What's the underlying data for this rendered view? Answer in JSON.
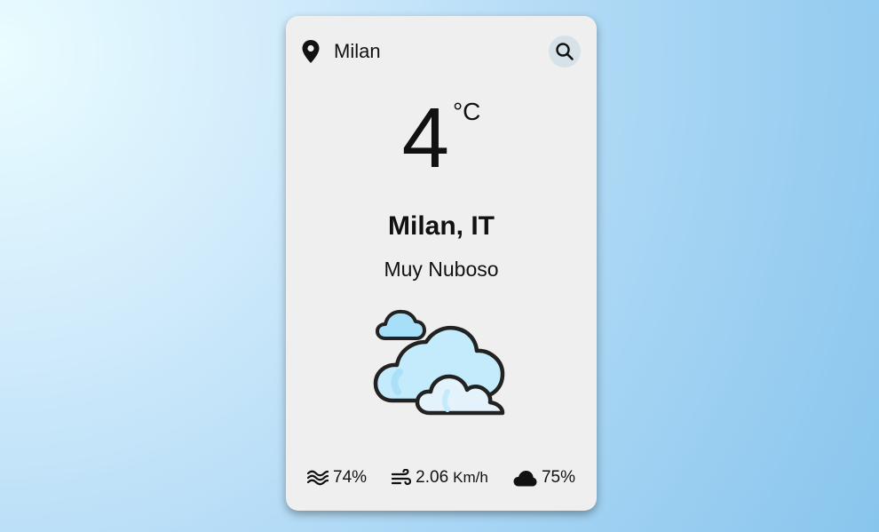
{
  "header": {
    "location": "Milan",
    "location_icon": "map-pin-icon",
    "search_icon": "search-icon"
  },
  "current": {
    "temperature": "4",
    "unit": "°C",
    "city": "Milan, IT",
    "description": "Muy Nuboso",
    "condition_icon": "clouds-icon"
  },
  "stats": {
    "humidity": "74%",
    "wind_speed": "2.06",
    "wind_unit": "Km/h",
    "cloudiness": "75%"
  },
  "colors": {
    "card_bg": "#efefef",
    "search_bg": "#d6e2e8",
    "cloud_light": "#c9ecfb",
    "cloud_mid": "#9fdcf6",
    "outline": "#222222"
  }
}
